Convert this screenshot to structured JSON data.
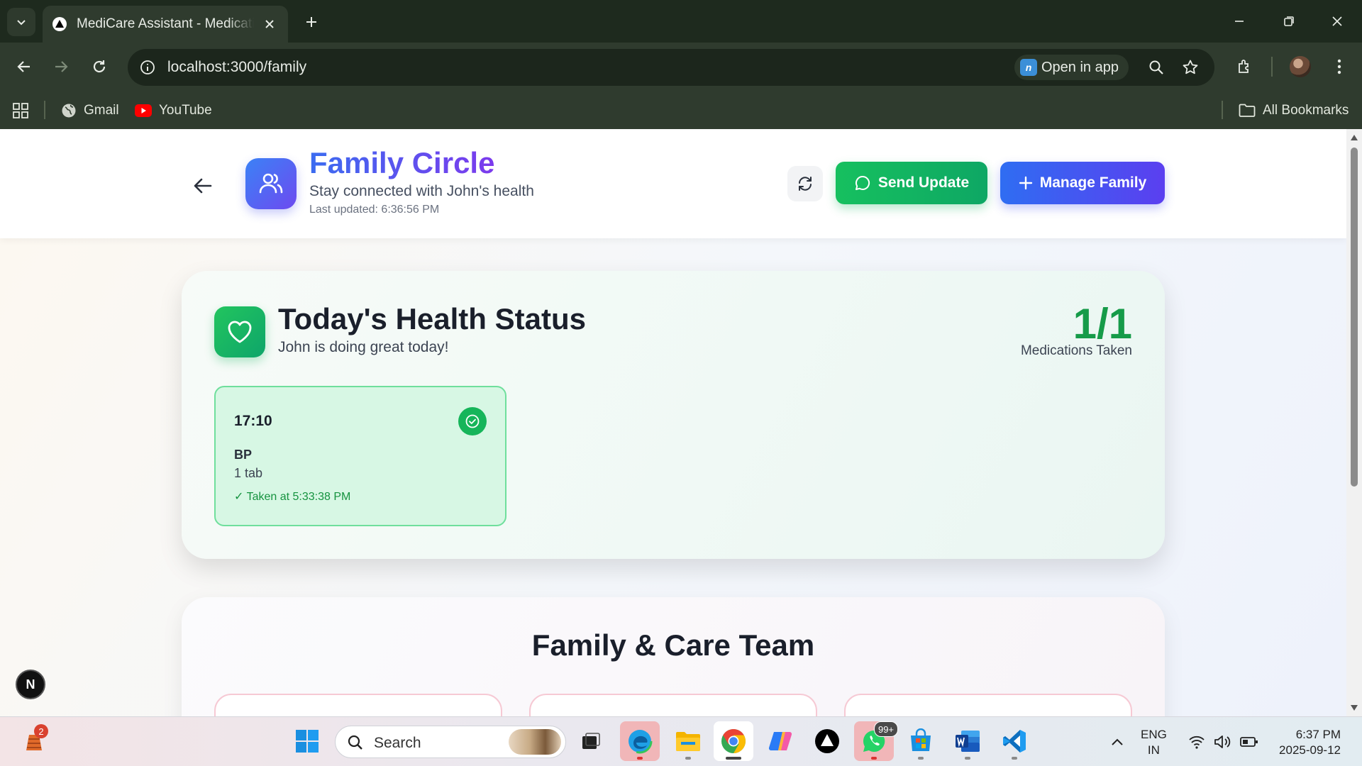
{
  "browser": {
    "tab_title": "MediCare Assistant - Medication",
    "url": "localhost:3000/family",
    "open_in_app": "Open in app",
    "bookmarks": [
      {
        "label": "Gmail"
      },
      {
        "label": "YouTube"
      }
    ],
    "all_bookmarks": "All Bookmarks"
  },
  "header": {
    "title": "Family Circle",
    "subtitle": "Stay connected with John's health",
    "last_updated": "Last updated: 6:36:56 PM",
    "send_update_label": "Send Update",
    "manage_family_label": "Manage Family"
  },
  "health_status": {
    "title": "Today's Health Status",
    "subtitle": "John is doing great today!",
    "count": "1/1",
    "count_label": "Medications Taken",
    "medications": [
      {
        "time": "17:10",
        "name": "BP",
        "dose": "1 tab",
        "taken": "✓ Taken at 5:33:38 PM"
      }
    ]
  },
  "team": {
    "title": "Family & Care Team"
  },
  "dev_badge": "N",
  "taskbar": {
    "search_label": "Search",
    "widget_badge": "2",
    "whatsapp_badge": "99+",
    "lang_line1": "ENG",
    "lang_line2": "IN",
    "time": "6:37 PM",
    "date": "2025-09-12"
  },
  "colors": {
    "accent_blue": "#3b6cf0",
    "accent_purple": "#7c3aed",
    "success_green": "#16b55a",
    "chrome_dark": "#2f3b2e"
  }
}
